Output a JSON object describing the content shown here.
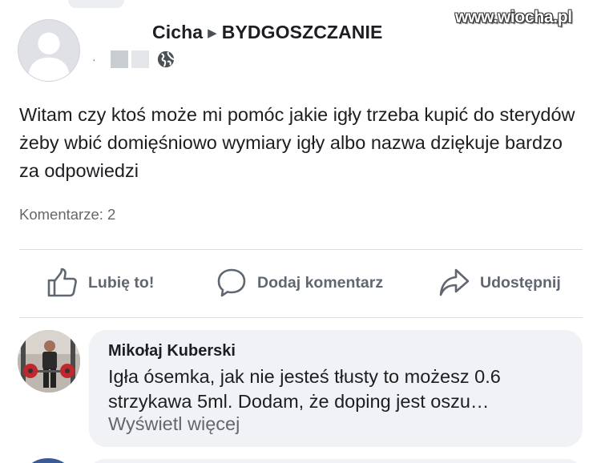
{
  "post": {
    "author_partial": "Cicha",
    "group": "BYDGOSZCZANIE",
    "meta_dot": "·",
    "text": "Witam czy ktoś może mi pomóc jakie igły trzeba kupić do sterydów żeby wbić domięśniowo wymiary igły albo nazwa dziękuje bardzo za odpowiedzi",
    "comments_count": "Komentarze: 2"
  },
  "watermark": "www.wiocha.pl",
  "actions": {
    "like": "Lubię to!",
    "comment": "Dodaj komentarz",
    "share": "Udostępnij"
  },
  "comment": {
    "author": "Mikołaj Kuberski",
    "text": "Igła ósemka, jak nie jesteś tłusty to możesz 0.6 strzykawa 5ml. Dodam, że doping jest oszu…",
    "more": "Wyświetl więcej"
  },
  "icons": {
    "avatar": "default-profile-icon",
    "privacy": "globe-icon",
    "like": "thumbs-up-icon",
    "comment": "speech-bubble-icon",
    "share": "share-arrow-icon"
  },
  "colors": {
    "text": "#1c1e21",
    "secondary": "#65676b",
    "action": "#606770",
    "bubble": "#f0f2f5",
    "divider": "#dadde1"
  }
}
